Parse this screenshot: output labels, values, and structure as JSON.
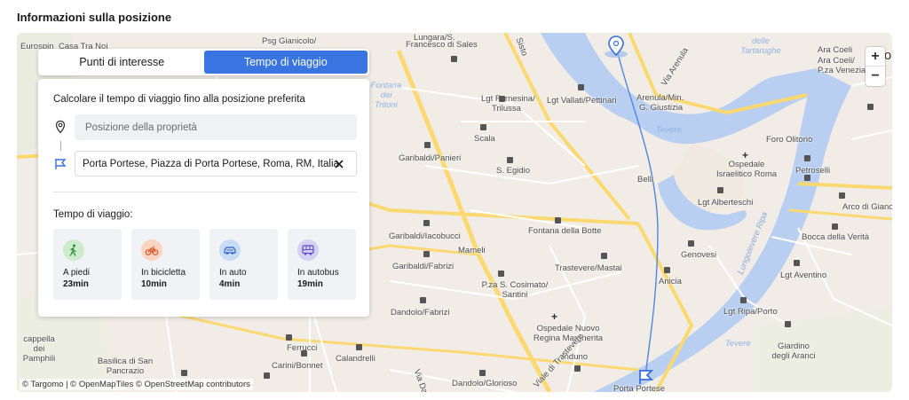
{
  "section": {
    "title": "Informazioni sulla posizione"
  },
  "tabs": [
    {
      "label": "Punti di interesse",
      "active": false
    },
    {
      "label": "Tempo di viaggio",
      "active": true
    }
  ],
  "panel": {
    "heading": "Calcolare il tempo di viaggio fino alla posizione preferita",
    "origin": {
      "placeholder": "Posizione della proprietà",
      "value": ""
    },
    "destination": {
      "value": "Porta Portese, Piazza di Porta Portese, Roma, RM, Italia"
    },
    "travel_time_label": "Tempo di viaggio:",
    "modes": [
      {
        "icon": "walking-icon",
        "label": "A piedi",
        "time": "23min",
        "color": "#cdeccb"
      },
      {
        "icon": "bicycle-icon",
        "label": "In bicicletta",
        "time": "10min",
        "color": "#fbd5c2"
      },
      {
        "icon": "car-icon",
        "label": "In auto",
        "time": "4min",
        "color": "#c9dcf5"
      },
      {
        "icon": "bus-icon",
        "label": "In autobus",
        "time": "19min",
        "color": "#d6d0f2"
      }
    ]
  },
  "map": {
    "zoom_in": "+",
    "zoom_out": "−",
    "attribution": "© Targomo | © OpenMapTiles © OpenStreetMap contributors",
    "labels": {
      "eurospin": "Eurospin",
      "casa_tra_noi": "Casa Tra Noi",
      "lungara": "Lungara/S.",
      "francesco_sales": "Francesco di Sales",
      "psg_gianicolo": "Psg Gianicolo/",
      "lgt_farnesina": "Lgt Farnesina/",
      "trilussa": "Trilussa",
      "lgt_vallati": "Lgt Vallati/Pettinari",
      "arenula": "Arenula/Min.",
      "g_giustizia": "G. Giustizia",
      "delle_tartarughe": "delle\nTartarughe",
      "ara_coeli": "Ara Coeli",
      "ara_coeli_2": "Ara Coeli/",
      "p_venezia": "P.za Venezia",
      "roma": "Ro",
      "fontana_tritoni": "Fontana\ndei\nTritoni",
      "scala": "Scala",
      "foro_olitorio": "Foro Olitorio",
      "garibaldi_panieri": "Garibaldi/Panieri",
      "s_egidio": "S. Egidio",
      "tevere": "Tevere",
      "petroselli": "Petroselli",
      "ospedale_israelitico": "Ospedale\nIsraelitico Roma",
      "belli": "Belli",
      "lgt_alberteschi": "Lgt Alberteschi",
      "arco_giano": "Arco di Giano",
      "garibaldi_iacobucci": "Garibaldi/Iacobucci",
      "fontana_botte": "Fontana della Botte",
      "bocca_verita": "Bocca della Verità",
      "mameli": "Mameli",
      "genovesi": "Genovesi",
      "garibaldi_fabrizi": "Garibaldi/Fabrizi",
      "trastevere_mastai": "Trastevere/Mastai",
      "lungotevere_ripa": "Lungotevere Ripa",
      "lgt_aventino": "Lgt Aventino",
      "pza_cosimato": "P.za S. Cosimato/\nSantini",
      "anicia": "Anicia",
      "dandolo_fabrizi": "Dandolo/Fabrizi",
      "lgt_ripa_porto": "Lgt Ripa/Porto",
      "ospedale_nuovo": "Ospedale Nuovo\nRegina Margherita",
      "cappella_pamphili": "cappella dei\nPamphili",
      "ferrucci": "Ferrucci",
      "tevere_2": "Tevere",
      "giardino_aranci": "Giardino\ndegli Aranci",
      "basilica_pancrazio": "Basilica di San\nPancrazio",
      "carini_bonnet": "Carini/Bonnet",
      "calandrelli": "Calandrelli",
      "induno": "Induno",
      "dandolo_glorioso": "Dandolo/Glorioso",
      "porta_portese": "Porta Portese",
      "via_dandolo": "Via Dandolo",
      "sisto": "Sisto",
      "arenula_via": "Via Arenula",
      "trastevere_via": "Viale di Trastevere"
    }
  }
}
